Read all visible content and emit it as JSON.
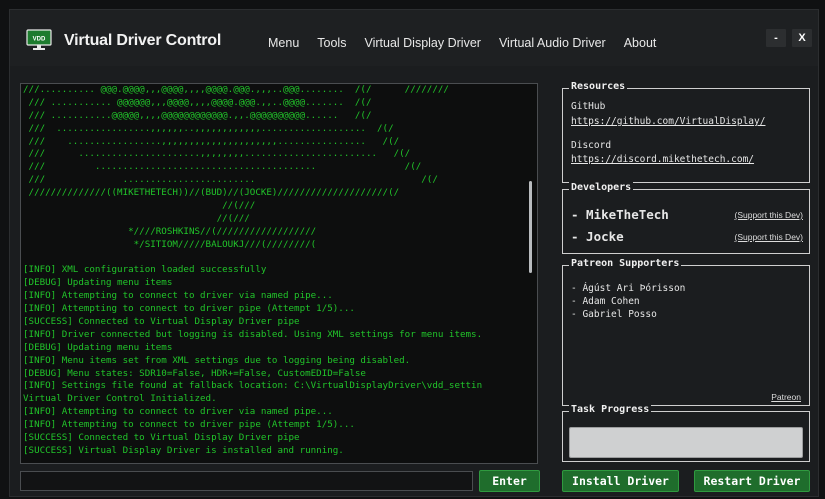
{
  "titlebar": {
    "app_title": "Virtual Driver Control",
    "icon": "monitor-vdd-icon",
    "icon_text": "VDD",
    "menu": [
      "Menu",
      "Tools",
      "Virtual Display Driver",
      "Virtual Audio Driver",
      "About"
    ],
    "minimize_label": "-",
    "close_label": "X"
  },
  "console": {
    "lines": [
      "///.......... @@@.@@@@,,,@@@@,,,,@@@@.@@@.,,,..@@@........  /(/      ////////",
      " /// ........... @@@@@@,,,@@@@,,,,@@@@.@@@.,,..@@@@.......  /(/",
      " /// ...........@@@@@,,,,@@@@@@@@@@@@.,,.@@@@@@@@@@......   /(/",
      " ///  .................,,,,,,..,,,,,,,,,,,,...................  /(/",
      " ///    .................,,,,,,,,,,,,,,,,,,,,,................   /(/",
      " ///      ......................,,,,,,,,........................   /(/",
      " ///         ........................................                /(/",
      " ///              ........................                              /(/",
      " //////////////((MIKETHETECH))//(BUD)//(JOCKE)////////////////////(/",
      "                                    //(///",
      "                                   //(///",
      "                   *////ROSHKINS//(//////////////////",
      "                    */SITIOM/////BALOUKJ///(////////(",
      "",
      "[INFO] XML configuration loaded successfully",
      "[DEBUG] Updating menu items",
      "[INFO] Attempting to connect to driver via named pipe...",
      "[INFO] Attempting to connect to driver pipe (Attempt 1/5)...",
      "[SUCCESS] Connected to Virtual Display Driver pipe",
      "[INFO] Driver connected but logging is disabled. Using XML settings for menu items.",
      "[DEBUG] Updating menu items",
      "[INFO] Menu items set from XML settings due to logging being disabled.",
      "[DEBUG] Menu states: SDR10=False, HDR+=False, CustomEDID=False",
      "[INFO] Settings file found at fallback location: C:\\VirtualDisplayDriver\\vdd_settin",
      "Virtual Driver Control Initialized.",
      "[INFO] Attempting to connect to driver via named pipe...",
      "[INFO] Attempting to connect to driver pipe (Attempt 1/5)...",
      "[SUCCESS] Connected to Virtual Display Driver pipe",
      "[SUCCESS] Virtual Display Driver is installed and running."
    ],
    "text_color": "#21c42a"
  },
  "command": {
    "value": "",
    "enter_label": "Enter"
  },
  "actions": {
    "install_label": "Install Driver",
    "restart_label": "Restart Driver",
    "accent": "#1f6d2c"
  },
  "resources": {
    "title": "Resources",
    "github_label": "GitHub",
    "github_url": "https://github.com/VirtualDisplay/",
    "discord_label": "Discord",
    "discord_url": "https://discord.mikethetech.com/"
  },
  "developers": {
    "title": "Developers",
    "items": [
      {
        "name": "- MikeTheTech",
        "support": "(Support this Dev)"
      },
      {
        "name": "- Jocke",
        "support": "(Support this Dev)"
      }
    ]
  },
  "patreon": {
    "title": "Patreon Supporters",
    "supporters": [
      "- Ágúst Ari Þórisson",
      "- Adam Cohen",
      "- Gabriel Posso"
    ],
    "link_label": "Patreon"
  },
  "progress": {
    "title": "Task Progress",
    "value_percent": 0
  }
}
